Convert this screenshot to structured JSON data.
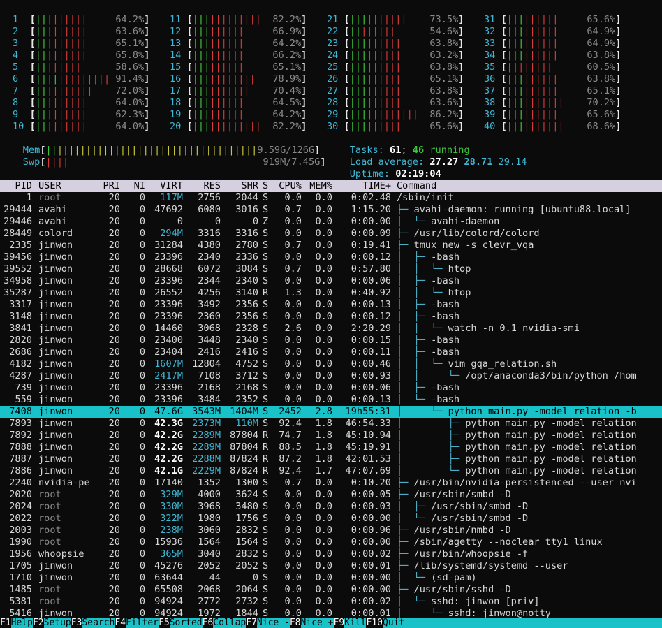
{
  "cpus": [
    {
      "id": "1",
      "pct": "64.2%"
    },
    {
      "id": "2",
      "pct": "63.6%"
    },
    {
      "id": "3",
      "pct": "65.1%"
    },
    {
      "id": "4",
      "pct": "65.8%"
    },
    {
      "id": "5",
      "pct": "58.6%"
    },
    {
      "id": "6",
      "pct": "91.4%"
    },
    {
      "id": "7",
      "pct": "72.0%"
    },
    {
      "id": "8",
      "pct": "64.0%"
    },
    {
      "id": "9",
      "pct": "62.3%"
    },
    {
      "id": "10",
      "pct": "64.0%"
    },
    {
      "id": "11",
      "pct": "82.2%"
    },
    {
      "id": "12",
      "pct": "66.9%"
    },
    {
      "id": "13",
      "pct": "64.2%"
    },
    {
      "id": "14",
      "pct": "66.2%"
    },
    {
      "id": "15",
      "pct": "65.1%"
    },
    {
      "id": "16",
      "pct": "78.9%"
    },
    {
      "id": "17",
      "pct": "70.4%"
    },
    {
      "id": "18",
      "pct": "64.5%"
    },
    {
      "id": "19",
      "pct": "64.2%"
    },
    {
      "id": "20",
      "pct": "82.2%"
    },
    {
      "id": "21",
      "pct": "73.5%"
    },
    {
      "id": "22",
      "pct": "54.6%"
    },
    {
      "id": "23",
      "pct": "63.8%"
    },
    {
      "id": "24",
      "pct": "63.2%"
    },
    {
      "id": "25",
      "pct": "63.8%"
    },
    {
      "id": "26",
      "pct": "65.1%"
    },
    {
      "id": "27",
      "pct": "63.8%"
    },
    {
      "id": "28",
      "pct": "63.6%"
    },
    {
      "id": "29",
      "pct": "86.2%"
    },
    {
      "id": "30",
      "pct": "65.6%"
    },
    {
      "id": "31",
      "pct": "65.6%"
    },
    {
      "id": "32",
      "pct": "64.9%"
    },
    {
      "id": "33",
      "pct": "64.9%"
    },
    {
      "id": "34",
      "pct": "63.8%"
    },
    {
      "id": "35",
      "pct": "60.5%"
    },
    {
      "id": "36",
      "pct": "63.8%"
    },
    {
      "id": "37",
      "pct": "65.1%"
    },
    {
      "id": "38",
      "pct": "70.2%"
    },
    {
      "id": "39",
      "pct": "65.6%"
    },
    {
      "id": "40",
      "pct": "68.6%"
    }
  ],
  "mem": {
    "label": "Mem",
    "value": "9.59G/126G"
  },
  "swp": {
    "label": "Swp",
    "value": "919M/7.45G"
  },
  "tasks": {
    "label": "Tasks:",
    "count": "61",
    "sep": ";",
    "running": "46",
    "running_label": "running"
  },
  "load": {
    "label": "Load average:",
    "v1": "27.27",
    "v2": "28.71",
    "v3": "29.14"
  },
  "uptime": {
    "label": "Uptime:",
    "value": "02:19:04"
  },
  "columns": {
    "pid": "PID",
    "user": "USER",
    "pri": "PRI",
    "ni": "NI",
    "virt": "VIRT",
    "res": "RES",
    "shr": "SHR",
    "s": "S",
    "cpu": "CPU%",
    "mem": "MEM%",
    "time": "TIME+",
    "cmd": "Command"
  },
  "processes": [
    {
      "pid": "1",
      "user": "root",
      "pri": "20",
      "ni": "0",
      "virt": "117M",
      "res": "2756",
      "shr": "2044",
      "s": "S",
      "cpu": "0.0",
      "mem": "0.0",
      "time": "0:02.48",
      "tree": "",
      "cmd": "/sbin/init"
    },
    {
      "pid": "29444",
      "user": "avahi",
      "pri": "20",
      "ni": "0",
      "virt": "47692",
      "res": "6080",
      "shr": "3016",
      "s": "S",
      "cpu": "0.7",
      "mem": "0.0",
      "time": "1:15.20",
      "tree": "├─ ",
      "cmd": "avahi-daemon: running [ubuntu88.local]"
    },
    {
      "pid": "29446",
      "user": "avahi",
      "pri": "20",
      "ni": "0",
      "virt": "0",
      "res": "0",
      "shr": "0",
      "s": "Z",
      "cpu": "0.0",
      "mem": "0.0",
      "time": "0:00.00",
      "tree": "│  └─ ",
      "cmd": "avahi-daemon"
    },
    {
      "pid": "28449",
      "user": "colord",
      "pri": "20",
      "ni": "0",
      "virt": "294M",
      "res": "3316",
      "shr": "3316",
      "s": "S",
      "cpu": "0.0",
      "mem": "0.0",
      "time": "0:00.09",
      "tree": "├─ ",
      "cmd": "/usr/lib/colord/colord"
    },
    {
      "pid": "2335",
      "user": "jinwon",
      "pri": "20",
      "ni": "0",
      "virt": "31284",
      "res": "4380",
      "shr": "2780",
      "s": "S",
      "cpu": "0.7",
      "mem": "0.0",
      "time": "0:19.41",
      "tree": "├─ ",
      "cmd": "tmux new -s clevr_vqa"
    },
    {
      "pid": "39456",
      "user": "jinwon",
      "pri": "20",
      "ni": "0",
      "virt": "23396",
      "res": "2340",
      "shr": "2336",
      "s": "S",
      "cpu": "0.0",
      "mem": "0.0",
      "time": "0:00.12",
      "tree": "│  ├─ ",
      "cmd": "-bash"
    },
    {
      "pid": "39552",
      "user": "jinwon",
      "pri": "20",
      "ni": "0",
      "virt": "28668",
      "res": "6072",
      "shr": "3084",
      "s": "S",
      "cpu": "0.7",
      "mem": "0.0",
      "time": "0:57.80",
      "tree": "│  │  └─ ",
      "cmd": "htop"
    },
    {
      "pid": "34958",
      "user": "jinwon",
      "pri": "20",
      "ni": "0",
      "virt": "23396",
      "res": "2344",
      "shr": "2340",
      "s": "S",
      "cpu": "0.0",
      "mem": "0.0",
      "time": "0:00.06",
      "tree": "│  ├─ ",
      "cmd": "-bash"
    },
    {
      "pid": "35287",
      "user": "jinwon",
      "pri": "20",
      "ni": "0",
      "virt": "26552",
      "res": "4256",
      "shr": "3140",
      "s": "R",
      "cpu": "1.3",
      "mem": "0.0",
      "time": "0:40.92",
      "tree": "│  │  └─ ",
      "cmd": "htop"
    },
    {
      "pid": "3317",
      "user": "jinwon",
      "pri": "20",
      "ni": "0",
      "virt": "23396",
      "res": "3492",
      "shr": "2356",
      "s": "S",
      "cpu": "0.0",
      "mem": "0.0",
      "time": "0:00.13",
      "tree": "│  ├─ ",
      "cmd": "-bash"
    },
    {
      "pid": "3148",
      "user": "jinwon",
      "pri": "20",
      "ni": "0",
      "virt": "23396",
      "res": "2360",
      "shr": "2356",
      "s": "S",
      "cpu": "0.0",
      "mem": "0.0",
      "time": "0:00.12",
      "tree": "│  ├─ ",
      "cmd": "-bash"
    },
    {
      "pid": "3841",
      "user": "jinwon",
      "pri": "20",
      "ni": "0",
      "virt": "14460",
      "res": "3068",
      "shr": "2328",
      "s": "S",
      "cpu": "2.6",
      "mem": "0.0",
      "time": "2:20.29",
      "tree": "│  │  └─ ",
      "cmd": "watch -n 0.1 nvidia-smi"
    },
    {
      "pid": "2820",
      "user": "jinwon",
      "pri": "20",
      "ni": "0",
      "virt": "23400",
      "res": "3448",
      "shr": "2340",
      "s": "S",
      "cpu": "0.0",
      "mem": "0.0",
      "time": "0:00.15",
      "tree": "│  ├─ ",
      "cmd": "-bash"
    },
    {
      "pid": "2686",
      "user": "jinwon",
      "pri": "20",
      "ni": "0",
      "virt": "23404",
      "res": "2416",
      "shr": "2416",
      "s": "S",
      "cpu": "0.0",
      "mem": "0.0",
      "time": "0:00.11",
      "tree": "│  ├─ ",
      "cmd": "-bash"
    },
    {
      "pid": "4182",
      "user": "jinwon",
      "pri": "20",
      "ni": "0",
      "virt": "1607M",
      "res": "12804",
      "shr": "4752",
      "s": "S",
      "cpu": "0.0",
      "mem": "0.0",
      "time": "0:00.46",
      "tree": "│  │  └─ ",
      "cmd": "vim gqa_relation.sh"
    },
    {
      "pid": "4287",
      "user": "jinwon",
      "pri": "20",
      "ni": "0",
      "virt": "2417M",
      "res": "7108",
      "shr": "3712",
      "s": "S",
      "cpu": "0.0",
      "mem": "0.0",
      "time": "0:00.93",
      "tree": "│  │     └─ ",
      "cmd": "/opt/anaconda3/bin/python /hom"
    },
    {
      "pid": "739",
      "user": "jinwon",
      "pri": "20",
      "ni": "0",
      "virt": "23396",
      "res": "2168",
      "shr": "2168",
      "s": "S",
      "cpu": "0.0",
      "mem": "0.0",
      "time": "0:00.06",
      "tree": "│  ├─ ",
      "cmd": "-bash"
    },
    {
      "pid": "559",
      "user": "jinwon",
      "pri": "20",
      "ni": "0",
      "virt": "23396",
      "res": "3484",
      "shr": "2352",
      "s": "S",
      "cpu": "0.0",
      "mem": "0.0",
      "time": "0:00.13",
      "tree": "│  └─ ",
      "cmd": "-bash"
    },
    {
      "pid": "7408",
      "user": "jinwon",
      "pri": "20",
      "ni": "0",
      "virt": "47.6G",
      "res": "3543M",
      "shr": "1404M",
      "s": "S",
      "cpu": "2452",
      "mem": "2.8",
      "time": "19h55:31",
      "tree": "│     └─ ",
      "cmd": "python main.py -model relation -b",
      "selected": true
    },
    {
      "pid": "7893",
      "user": "jinwon",
      "pri": "20",
      "ni": "0",
      "virt": "42.3G",
      "res": "2373M",
      "shr": "110M",
      "s": "S",
      "cpu": "92.4",
      "mem": "1.8",
      "time": "46:54.33",
      "tree": "│        ├─ ",
      "cmd": "python main.py -model relation"
    },
    {
      "pid": "7892",
      "user": "jinwon",
      "pri": "20",
      "ni": "0",
      "virt": "42.2G",
      "res": "2289M",
      "shr": "87804",
      "s": "R",
      "cpu": "74.7",
      "mem": "1.8",
      "time": "45:10.94",
      "tree": "│        ├─ ",
      "cmd": "python main.py -model relation"
    },
    {
      "pid": "7888",
      "user": "jinwon",
      "pri": "20",
      "ni": "0",
      "virt": "42.2G",
      "res": "2289M",
      "shr": "87804",
      "s": "R",
      "cpu": "88.5",
      "mem": "1.8",
      "time": "45:19.91",
      "tree": "│        ├─ ",
      "cmd": "python main.py -model relation"
    },
    {
      "pid": "7887",
      "user": "jinwon",
      "pri": "20",
      "ni": "0",
      "virt": "42.2G",
      "res": "2288M",
      "shr": "87824",
      "s": "R",
      "cpu": "87.2",
      "mem": "1.8",
      "time": "42:01.53",
      "tree": "│        ├─ ",
      "cmd": "python main.py -model relation"
    },
    {
      "pid": "7886",
      "user": "jinwon",
      "pri": "20",
      "ni": "0",
      "virt": "42.1G",
      "res": "2229M",
      "shr": "87824",
      "s": "R",
      "cpu": "92.4",
      "mem": "1.7",
      "time": "47:07.69",
      "tree": "│        └─ ",
      "cmd": "python main.py -model relation"
    },
    {
      "pid": "2240",
      "user": "nvidia-pe",
      "pri": "20",
      "ni": "0",
      "virt": "17140",
      "res": "1352",
      "shr": "1300",
      "s": "S",
      "cpu": "0.7",
      "mem": "0.0",
      "time": "0:10.20",
      "tree": "├─ ",
      "cmd": "/usr/bin/nvidia-persistenced --user nvi"
    },
    {
      "pid": "2020",
      "user": "root",
      "pri": "20",
      "ni": "0",
      "virt": "329M",
      "res": "4000",
      "shr": "3624",
      "s": "S",
      "cpu": "0.0",
      "mem": "0.0",
      "time": "0:00.05",
      "tree": "├─ ",
      "cmd": "/usr/sbin/smbd -D"
    },
    {
      "pid": "2024",
      "user": "root",
      "pri": "20",
      "ni": "0",
      "virt": "330M",
      "res": "3968",
      "shr": "3480",
      "s": "S",
      "cpu": "0.0",
      "mem": "0.0",
      "time": "0:00.03",
      "tree": "│  ├─ ",
      "cmd": "/usr/sbin/smbd -D"
    },
    {
      "pid": "2022",
      "user": "root",
      "pri": "20",
      "ni": "0",
      "virt": "322M",
      "res": "1980",
      "shr": "1756",
      "s": "S",
      "cpu": "0.0",
      "mem": "0.0",
      "time": "0:00.00",
      "tree": "│  └─ ",
      "cmd": "/usr/sbin/smbd -D"
    },
    {
      "pid": "2003",
      "user": "root",
      "pri": "20",
      "ni": "0",
      "virt": "238M",
      "res": "3060",
      "shr": "2832",
      "s": "S",
      "cpu": "0.0",
      "mem": "0.0",
      "time": "0:00.96",
      "tree": "├─ ",
      "cmd": "/usr/sbin/nmbd -D"
    },
    {
      "pid": "1990",
      "user": "root",
      "pri": "20",
      "ni": "0",
      "virt": "15936",
      "res": "1564",
      "shr": "1564",
      "s": "S",
      "cpu": "0.0",
      "mem": "0.0",
      "time": "0:00.00",
      "tree": "├─ ",
      "cmd": "/sbin/agetty --noclear tty1 linux"
    },
    {
      "pid": "1956",
      "user": "whoopsie",
      "pri": "20",
      "ni": "0",
      "virt": "365M",
      "res": "3040",
      "shr": "2832",
      "s": "S",
      "cpu": "0.0",
      "mem": "0.0",
      "time": "0:00.02",
      "tree": "├─ ",
      "cmd": "/usr/bin/whoopsie -f"
    },
    {
      "pid": "1705",
      "user": "jinwon",
      "pri": "20",
      "ni": "0",
      "virt": "45276",
      "res": "2052",
      "shr": "2052",
      "s": "S",
      "cpu": "0.0",
      "mem": "0.0",
      "time": "0:00.01",
      "tree": "├─ ",
      "cmd": "/lib/systemd/systemd --user"
    },
    {
      "pid": "1710",
      "user": "jinwon",
      "pri": "20",
      "ni": "0",
      "virt": "63644",
      "res": "44",
      "shr": "0",
      "s": "S",
      "cpu": "0.0",
      "mem": "0.0",
      "time": "0:00.00",
      "tree": "│  └─ ",
      "cmd": "(sd-pam)"
    },
    {
      "pid": "1485",
      "user": "root",
      "pri": "20",
      "ni": "0",
      "virt": "65508",
      "res": "2068",
      "shr": "2064",
      "s": "S",
      "cpu": "0.0",
      "mem": "0.0",
      "time": "0:00.00",
      "tree": "├─ ",
      "cmd": "/usr/sbin/sshd -D"
    },
    {
      "pid": "5381",
      "user": "root",
      "pri": "20",
      "ni": "0",
      "virt": "94924",
      "res": "2772",
      "shr": "2732",
      "s": "S",
      "cpu": "0.0",
      "mem": "0.0",
      "time": "0:00.02",
      "tree": "│  └─ ",
      "cmd": "sshd: jinwon [priv]"
    },
    {
      "pid": "5416",
      "user": "jinwon",
      "pri": "20",
      "ni": "0",
      "virt": "94924",
      "res": "1972",
      "shr": "1844",
      "s": "S",
      "cpu": "0.0",
      "mem": "0.0",
      "time": "0:00.01",
      "tree": "│     └─ ",
      "cmd": "sshd: jinwon@notty"
    }
  ],
  "footer": [
    {
      "key": "F1",
      "label": "Help"
    },
    {
      "key": "F2",
      "label": "Setup"
    },
    {
      "key": "F3",
      "label": "Search"
    },
    {
      "key": "F4",
      "label": "Filter"
    },
    {
      "key": "F5",
      "label": "Sorted"
    },
    {
      "key": "F6",
      "label": "Collap"
    },
    {
      "key": "F7",
      "label": "Nice -"
    },
    {
      "key": "F8",
      "label": "Nice +"
    },
    {
      "key": "F9",
      "label": "Kill"
    },
    {
      "key": "F10",
      "label": "Quit"
    }
  ],
  "colors": {
    "header_bg": "#d6cfe0",
    "selected_bg": "#19c2c8",
    "cpu_id": "#3fb6d3",
    "bar_low": "#3cc83c",
    "bar_high": "#d83c3c"
  }
}
